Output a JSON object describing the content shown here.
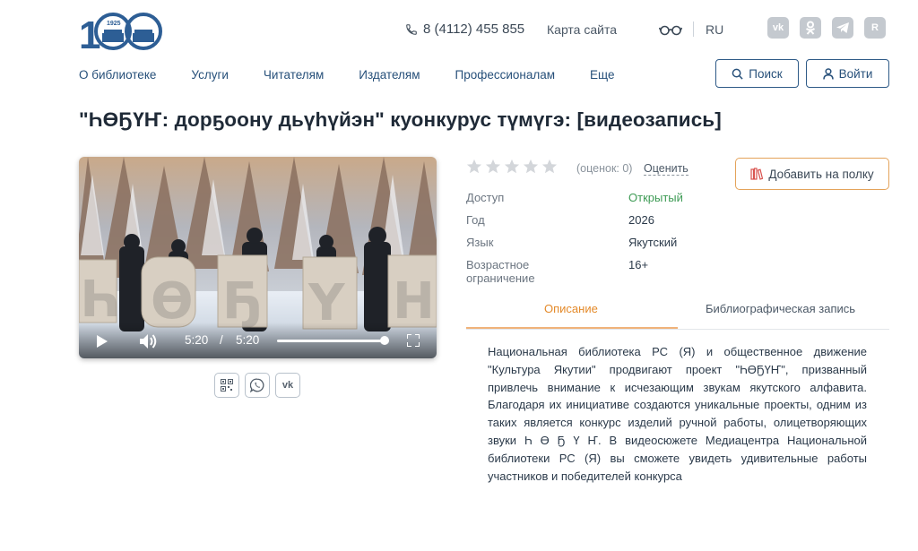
{
  "header": {
    "logo_year": "1925",
    "logo_number": "100",
    "phone": "8 (4112) 455 855",
    "sitemap": "Карта сайта",
    "lang": "RU",
    "socials": [
      {
        "icon": "vk-icon",
        "label": "vk"
      },
      {
        "icon": "odnoklassniki-icon",
        "label": "ok"
      },
      {
        "icon": "telegram-icon",
        "label": ""
      },
      {
        "icon": "rutube-icon",
        "label": "R"
      }
    ]
  },
  "nav": {
    "items": [
      "О библиотеке",
      "Услуги",
      "Читателям",
      "Издателям",
      "Профессионалам",
      "Еще"
    ],
    "search_label": "Поиск",
    "login_label": "Войти"
  },
  "page": {
    "title": "\"ҺӨҔҮҤ: дорҕоону дьүһүйэн\" куонкурус түмүгэ: [видеозапись]"
  },
  "video": {
    "current_time": "5:20",
    "separator": "/",
    "duration": "5:20",
    "progress": 1.0,
    "letters": [
      "Һ",
      "Ө",
      "Ҕ",
      "Ү",
      "Н"
    ]
  },
  "rating": {
    "stars_filled": 0,
    "stars_total": 5,
    "count_text": "(оценок: 0)",
    "rate_label": "Оценить"
  },
  "shelf_button": "Добавить на полку",
  "properties": [
    {
      "key": "Доступ",
      "value": "Открытый"
    },
    {
      "key": "Год",
      "value": "2026"
    },
    {
      "key": "Язык",
      "value": "Якутский"
    },
    {
      "key": "Возрастное ограничение",
      "value": "16+"
    }
  ],
  "tabs": {
    "description": "Описание",
    "bibliographic": "Библиографическая запись"
  },
  "description": "Национальная библиотека РС (Я) и общественное движение \"Культура Якутии\" продвигают проект \"ҺӨҔҮҤ\", призванный привлечь внимание к исчезающим звукам якутского алфавита. Благодаря их инициативе создаются уникальные проекты, одним из таких является конкурс изделий ручной работы, олицетворяющих звуки Һ Ө Ҕ Ү Ҥ. В видеосюжете Медиацентра Национальной библиотеки РС (Я) вы сможете увидеть удивительные работы участников и победителей конкурса",
  "colors": {
    "nav": "#27507a",
    "accent_orange": "#e48a2a",
    "open_green": "#3e9b55",
    "logo_blue": "#2d5e95"
  }
}
